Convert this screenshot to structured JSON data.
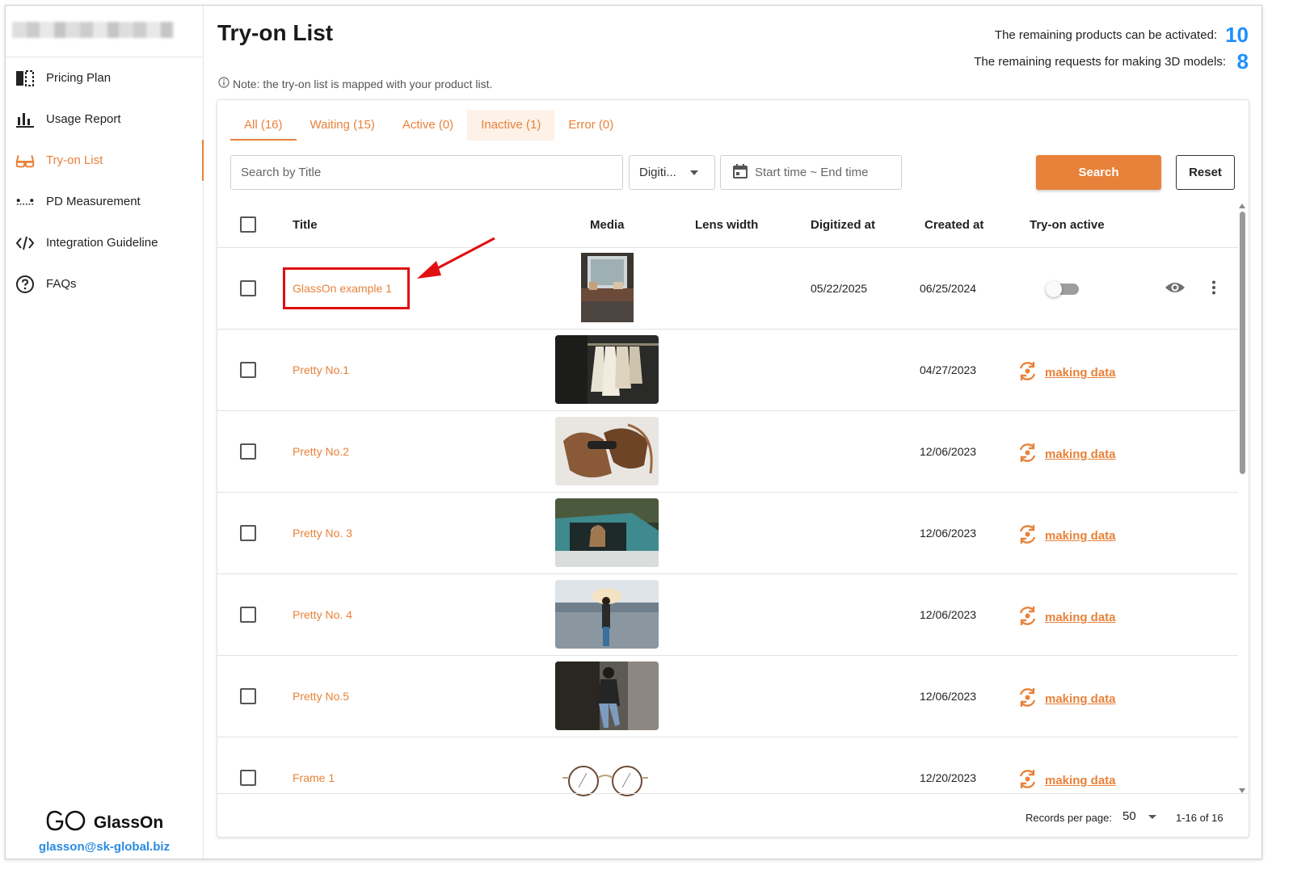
{
  "sidebar": {
    "items": [
      {
        "label": "Pricing Plan",
        "icon": "pricing-plan-icon",
        "active": false
      },
      {
        "label": "Usage Report",
        "icon": "bar-chart-icon",
        "active": false
      },
      {
        "label": "Try-on List",
        "icon": "glasses-icon",
        "active": true
      },
      {
        "label": "PD Measurement",
        "icon": "pd-measurement-icon",
        "active": false
      },
      {
        "label": "Integration Guideline",
        "icon": "code-icon",
        "active": false
      },
      {
        "label": "FAQs",
        "icon": "help-circle-icon",
        "active": false
      }
    ],
    "brand": {
      "name": "GlassOn",
      "email": "glasson@sk-global.biz"
    }
  },
  "header": {
    "title": "Try-on List",
    "stats": [
      {
        "label": "The remaining products can be activated:",
        "value": "10"
      },
      {
        "label": "The remaining requests for making 3D models:",
        "value": "8"
      }
    ],
    "note": "Note: the try-on list is mapped with your product list."
  },
  "tabs": [
    {
      "label": "All (16)",
      "active": true
    },
    {
      "label": "Waiting (15)",
      "active": false
    },
    {
      "label": "Active (0)",
      "active": false
    },
    {
      "label": "Inactive (1)",
      "active": false
    },
    {
      "label": "Error (0)",
      "active": false
    }
  ],
  "filters": {
    "search_placeholder": "Search by Title",
    "select_value": "Digiti...",
    "date_placeholder": "Start time ~ End time",
    "search_label": "Search",
    "reset_label": "Reset"
  },
  "table": {
    "columns": [
      "Title",
      "Media",
      "Lens width",
      "Digitized at",
      "Created at",
      "Try-on active"
    ],
    "rows": [
      {
        "title": "GlassOn example 1",
        "media": "mirror-vanity-photo",
        "lens_width": "",
        "digitized_at": "05/22/2025",
        "created_at": "06/25/2024",
        "status": "toggle-off"
      },
      {
        "title": "Pretty No.1",
        "media": "clothes-rack-photo",
        "lens_width": "",
        "digitized_at": "",
        "created_at": "04/27/2023",
        "status": "making data"
      },
      {
        "title": "Pretty No.2",
        "media": "leather-bag-photo",
        "lens_width": "",
        "digitized_at": "",
        "created_at": "12/06/2023",
        "status": "making data"
      },
      {
        "title": "Pretty No. 3",
        "media": "woman-in-truck-photo",
        "lens_width": "",
        "digitized_at": "",
        "created_at": "12/06/2023",
        "status": "making data"
      },
      {
        "title": "Pretty No. 4",
        "media": "woman-parking-lot-photo",
        "lens_width": "",
        "digitized_at": "",
        "created_at": "12/06/2023",
        "status": "making data"
      },
      {
        "title": "Pretty No.5",
        "media": "woman-by-wall-photo",
        "lens_width": "",
        "digitized_at": "",
        "created_at": "12/06/2023",
        "status": "making data"
      },
      {
        "title": "Frame 1",
        "media": "round-glasses-frame",
        "lens_width": "",
        "digitized_at": "",
        "created_at": "12/20/2023",
        "status": "making data"
      }
    ]
  },
  "footer": {
    "records_label": "Records per page:",
    "records_value": "50",
    "range": "1-16 of 16"
  },
  "colors": {
    "accent": "#e8823a",
    "stat_number": "#1e90ff",
    "annotation": "#e01010"
  }
}
